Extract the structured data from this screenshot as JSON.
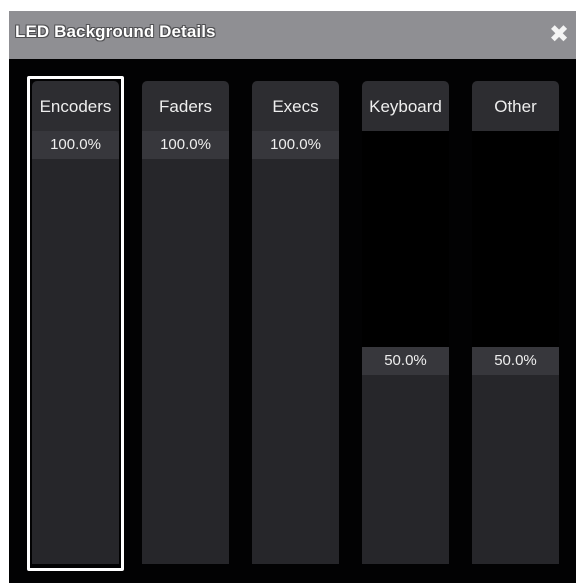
{
  "window": {
    "title": "LED Background Details",
    "close_icon": "close-icon"
  },
  "columns": [
    {
      "label": "Encoders",
      "value": "100.0%",
      "level": 1.0,
      "selected": true
    },
    {
      "label": "Faders",
      "value": "100.0%",
      "level": 1.0,
      "selected": false
    },
    {
      "label": "Execs",
      "value": "100.0%",
      "level": 1.0,
      "selected": false
    },
    {
      "label": "Keyboard",
      "value": "50.0%",
      "level": 0.5,
      "selected": false
    },
    {
      "label": "Other",
      "value": "50.0%",
      "level": 0.5,
      "selected": false
    }
  ],
  "colors": {
    "titlebar": "#8f8f93",
    "background": "#020203",
    "column_header": "#2d2d31",
    "fill": "#26262a",
    "value_label": "#37373c",
    "selection": "#ffffff"
  }
}
